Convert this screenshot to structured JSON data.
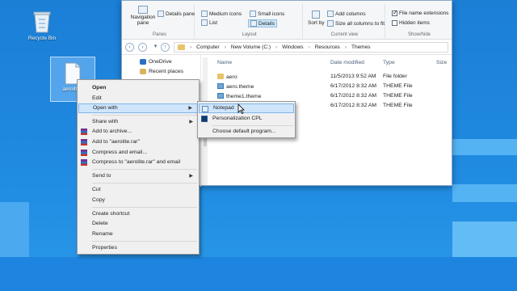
{
  "desktop": {
    "recycle_label": "Recycle Bin",
    "file_label": "aerolite.t"
  },
  "ribbon": {
    "nav_pane_label": "Navigation pane",
    "details_pane_label": "Details pane",
    "panes_group": "Panes",
    "medium_icons": "Medium icons",
    "small_icons": "Small icons",
    "list": "List",
    "details": "Details",
    "layout_group": "Layout",
    "sort_by": "Sort by",
    "add_columns": "Add columns",
    "size_all_columns": "Size all columns to fit",
    "current_view_group": "Current view",
    "file_name_extensions": "File name extensions",
    "hidden_items": "Hidden items",
    "show_hide_group": "Show/hide"
  },
  "address": {
    "crumbs": [
      "Computer",
      "New Volume (C:)",
      "Windows",
      "Resources",
      "Themes"
    ]
  },
  "nav_pane": {
    "items": [
      "OneDrive",
      "Recent places"
    ]
  },
  "file_list": {
    "columns": [
      "Name",
      "Date modified",
      "Type",
      "Size"
    ],
    "rows": [
      {
        "name": "aero",
        "date": "11/5/2013 9:52 AM",
        "type": "File folder",
        "size": ""
      },
      {
        "name": "aero.theme",
        "date": "6/17/2012 8:32 AM",
        "type": "THEME File",
        "size": ""
      },
      {
        "name": "theme1.theme",
        "date": "6/17/2012 8:32 AM",
        "type": "THEME File",
        "size": ""
      },
      {
        "name": "",
        "date": "6/17/2012 8:32 AM",
        "type": "THEME File",
        "size": ""
      }
    ]
  },
  "context_menu": {
    "items": [
      "Open",
      "Edit",
      "Open with",
      "Share with",
      "Add to archive...",
      "Add to \"aerolite.rar\"",
      "Compress and email...",
      "Compress to \"aerolite.rar\" and email",
      "Send to",
      "Cut",
      "Copy",
      "Create shortcut",
      "Delete",
      "Rename",
      "Properties"
    ]
  },
  "submenu": {
    "items": [
      "Notepad",
      "Personalization CPL",
      "Choose default program..."
    ]
  }
}
